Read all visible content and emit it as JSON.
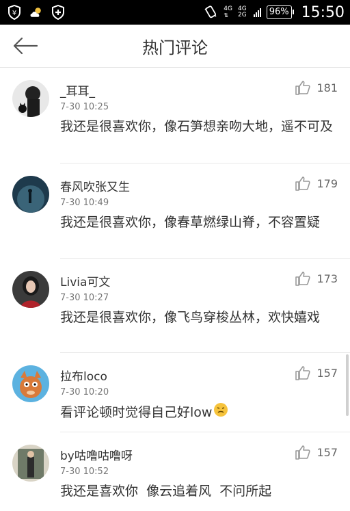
{
  "status_bar": {
    "network_top": "4G",
    "network_bottom": "2G",
    "network2": "4G",
    "battery": "96%",
    "time": "15:50"
  },
  "header": {
    "title": "热门评论"
  },
  "comments": [
    {
      "user": "_耳耳_",
      "time": "7-30 10:25",
      "likes": "181",
      "text": "我还是很喜欢你，像石笋想亲吻大地，遥不可及"
    },
    {
      "user": "春风吹张又生",
      "time": "7-30 10:49",
      "likes": "179",
      "text": "我还是很喜欢你，像春草燃绿山脊，不容置疑"
    },
    {
      "user": "Livia可文",
      "time": "7-30 10:27",
      "likes": "173",
      "text": "我还是很喜欢你，像飞鸟穿梭丛林，欢快嬉戏"
    },
    {
      "user": "拉布loco",
      "time": "7-30 10:20",
      "likes": "157",
      "text": "看评论顿时觉得自己好low"
    },
    {
      "user": "by咕噜咕噜呀",
      "time": "7-30 10:52",
      "likes": "157",
      "text": "我还是喜欢你  像云追着风  不问所起"
    }
  ]
}
